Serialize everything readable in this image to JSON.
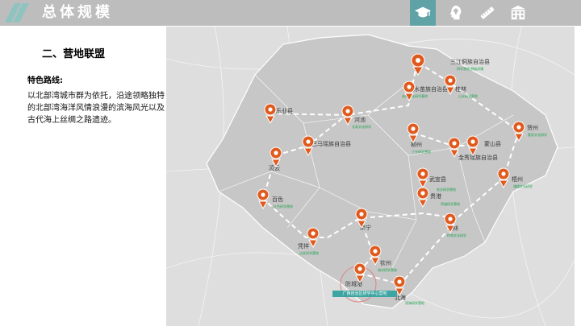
{
  "header": {
    "title": "总体规模",
    "nav_icons": [
      "graduation-cap-icon",
      "head-lightbulb-icon",
      "ruler-pencil-icon",
      "school-building-icon"
    ],
    "active_icon": "graduation-cap-icon",
    "colors": {
      "bar": "#bdbdbd",
      "active": "#5fa3a6",
      "logo": "#8fc3c0"
    }
  },
  "content": {
    "section_title": "二、营地联盟",
    "route_label": "特色路线:",
    "route_description": "以北部湾城市群为依托，沿途领略独特的北部湾海洋风情浪漫的滨海风光以及古代海上丝绸之路遗迹。"
  },
  "map": {
    "cities": [
      "三江侗族自治县",
      "融水苗族自治县",
      "桂林",
      "乐业县",
      "河池",
      "柳州",
      "贺州",
      "巴马瑶族自治县",
      "蒙山县",
      "金秀瑶族自治县",
      "凌云",
      "梧州",
      "武宣县",
      "贵港",
      "百色",
      "玉林",
      "南宁",
      "凭祥",
      "钦州",
      "防城港",
      "北海"
    ],
    "banner": "广西自治区研学中心营地",
    "pin_color": "#e05a1e",
    "note_color": "#1aa14a"
  }
}
